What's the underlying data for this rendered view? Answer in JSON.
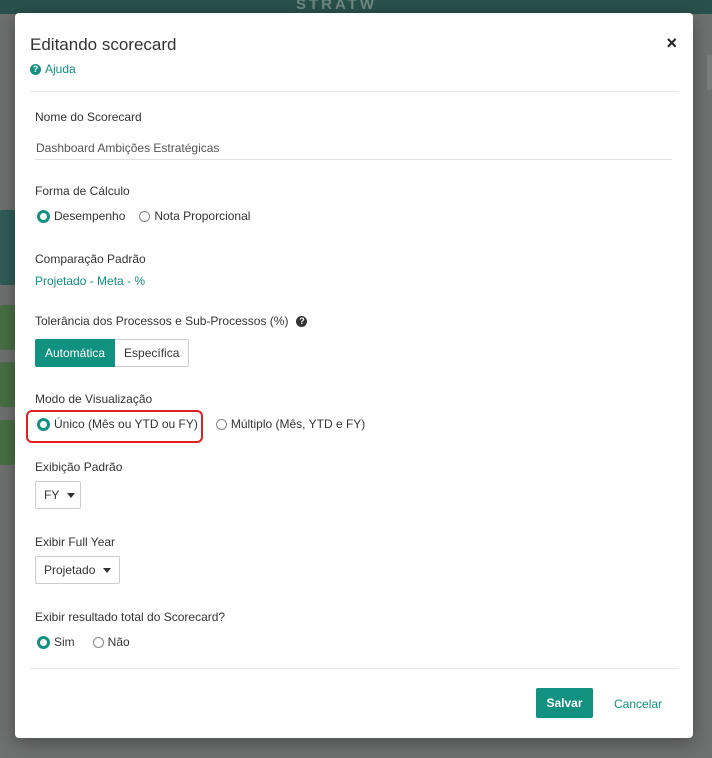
{
  "background": {
    "logo_text": "STRATW"
  },
  "modal": {
    "title": "Editando scorecard",
    "help_label": "Ajuda",
    "close_glyph": "×"
  },
  "fields": {
    "name": {
      "label": "Nome do Scorecard",
      "value": "Dashboard Ambições Estratégicas"
    },
    "calc_form": {
      "label": "Forma de Cálculo",
      "options": [
        "Desempenho",
        "Nota Proporcional"
      ],
      "selected": "Desempenho"
    },
    "comparison": {
      "label": "Comparação Padrão",
      "value": "Projetado - Meta - %"
    },
    "tolerance": {
      "label": "Tolerância dos Processos e Sub-Processos (%)",
      "options": [
        "Automática",
        "Específica"
      ],
      "selected": "Automática"
    },
    "view_mode": {
      "label": "Modo de Visualização",
      "options": [
        "Único (Mês ou YTD ou FY)",
        "Múltiplo (Mês, YTD e FY)"
      ],
      "selected": "Único (Mês ou YTD ou FY)"
    },
    "default_display": {
      "label": "Exibição Padrão",
      "value": "FY"
    },
    "full_year": {
      "label": "Exibir Full Year",
      "value": "Projetado"
    },
    "show_total": {
      "label": "Exibir resultado total do Scorecard?",
      "options": [
        "Sim",
        "Não"
      ],
      "selected": "Sim"
    }
  },
  "footer": {
    "save_label": "Salvar",
    "cancel_label": "Cancelar"
  },
  "colors": {
    "accent": "#11917f",
    "highlight": "#e02020"
  }
}
